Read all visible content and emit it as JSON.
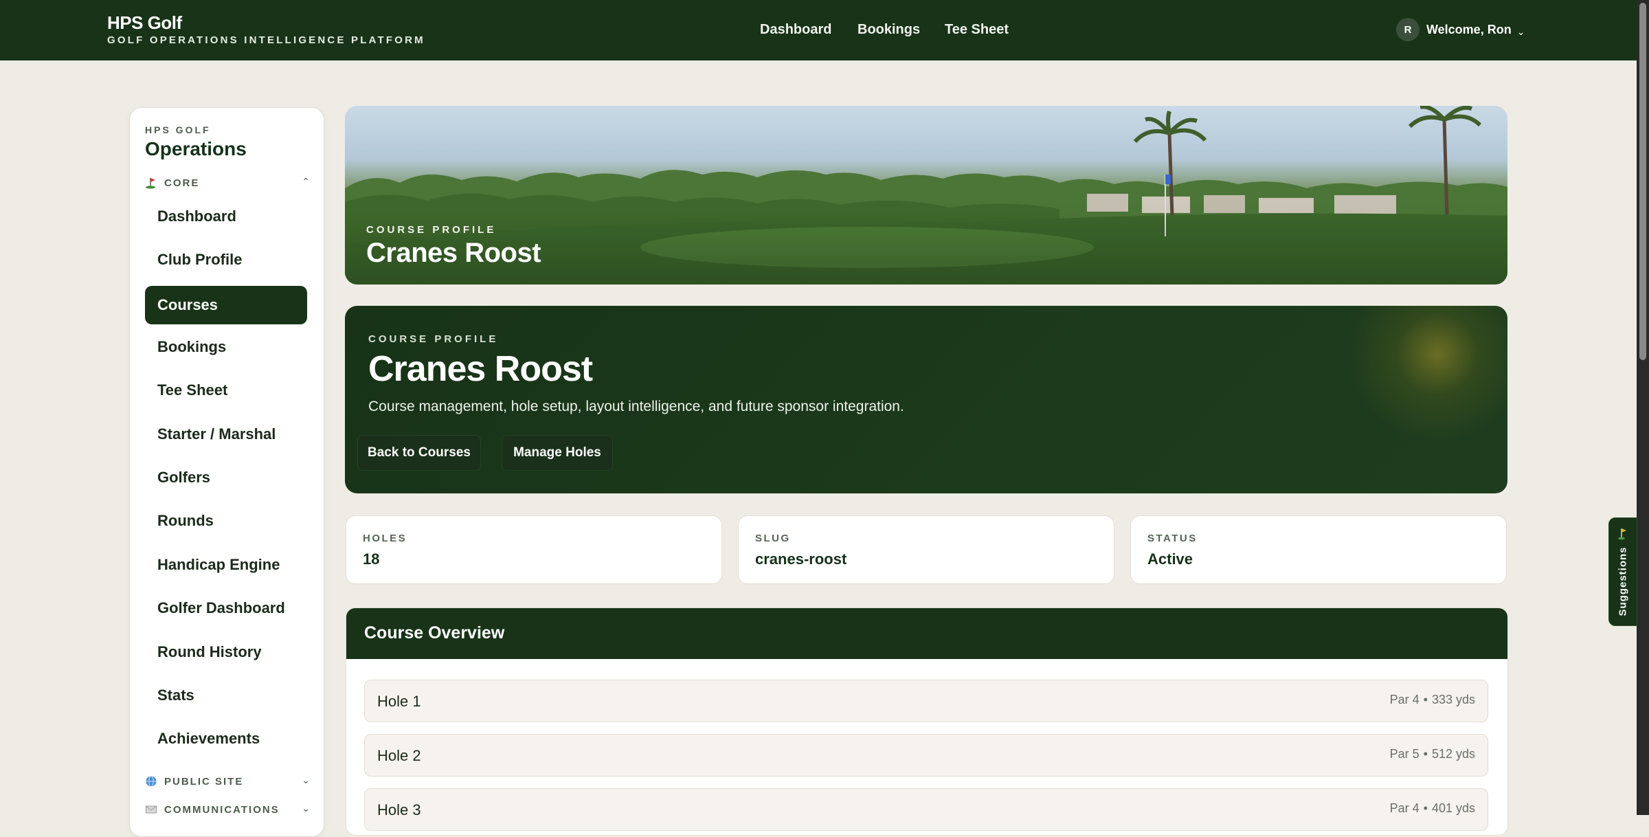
{
  "app": {
    "brand": "HPS Golf",
    "tagline": "GOLF OPERATIONS INTELLIGENCE PLATFORM"
  },
  "nav": {
    "links": [
      "Dashboard",
      "Bookings",
      "Tee Sheet"
    ],
    "user_initial": "R",
    "welcome": "Welcome, Ron"
  },
  "sidebar": {
    "eyebrow": "HPS GOLF",
    "title": "Operations",
    "sections": {
      "core": "CORE",
      "public_site": "PUBLIC SITE",
      "communications": "COMMUNICATIONS"
    },
    "items": [
      {
        "label": "Dashboard",
        "active": false
      },
      {
        "label": "Club Profile",
        "active": false
      },
      {
        "label": "Courses",
        "active": true
      },
      {
        "label": "Bookings",
        "active": false
      },
      {
        "label": "Tee Sheet",
        "active": false
      },
      {
        "label": "Starter / Marshal",
        "active": false
      },
      {
        "label": "Golfers",
        "active": false
      },
      {
        "label": "Rounds",
        "active": false
      },
      {
        "label": "Handicap Engine",
        "active": false
      },
      {
        "label": "Golfer Dashboard",
        "active": false
      },
      {
        "label": "Round History",
        "active": false
      },
      {
        "label": "Stats",
        "active": false
      },
      {
        "label": "Achievements",
        "active": false
      }
    ],
    "icons": {
      "core": "golf-flag-icon",
      "public_site": "globe-icon",
      "communications": "mail-icon"
    }
  },
  "banner": {
    "eyebrow": "COURSE PROFILE",
    "title": "Cranes Roost"
  },
  "profile": {
    "eyebrow": "COURSE PROFILE",
    "title": "Cranes Roost",
    "description": "Course management, hole setup, layout intelligence, and future sponsor integration.",
    "back_button": "Back to Courses",
    "manage_button": "Manage Holes"
  },
  "stats": [
    {
      "label": "HOLES",
      "value": "18"
    },
    {
      "label": "SLUG",
      "value": "cranes-roost"
    },
    {
      "label": "STATUS",
      "value": "Active"
    }
  ],
  "overview": {
    "title": "Course Overview",
    "holes": [
      {
        "name": "Hole 1",
        "par": "Par 4",
        "yards": "333 yds"
      },
      {
        "name": "Hole 2",
        "par": "Par 5",
        "yards": "512 yds"
      },
      {
        "name": "Hole 3",
        "par": "Par 4",
        "yards": "401 yds"
      }
    ]
  },
  "suggestions": {
    "label": "Suggestions"
  },
  "colors": {
    "primary": "#183318",
    "page_bg": "#efece5",
    "card_bg": "#ffffff",
    "row_bg": "#f6f3ee"
  }
}
